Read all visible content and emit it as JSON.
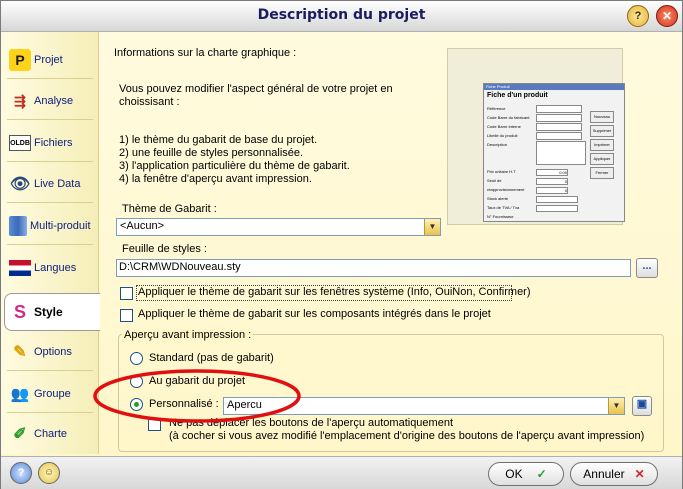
{
  "window": {
    "title": "Description du projet"
  },
  "sidebar": {
    "items": [
      {
        "label": "Projet",
        "icon": "p-icon"
      },
      {
        "label": "Analyse",
        "icon": "analysis-icon"
      },
      {
        "label": "Fichiers",
        "icon": "oldb-icon"
      },
      {
        "label": "Live Data",
        "icon": "eye-icon"
      },
      {
        "label": "Multi-produit",
        "icon": "books-icon"
      },
      {
        "label": "Langues",
        "icon": "flag-icon"
      },
      {
        "label": "Style",
        "icon": "style-icon",
        "selected": true
      },
      {
        "label": "Options",
        "icon": "pencil-icon"
      },
      {
        "label": "Groupe",
        "icon": "group-icon"
      },
      {
        "label": "Charte",
        "icon": "charte-icon"
      }
    ],
    "oldb_text": "OLDB"
  },
  "main": {
    "heading": "Informations sur la charte graphique :",
    "intro_line1": "Vous pouvez modifier l'aspect général de votre projet en",
    "intro_line2": "choissisant :",
    "list": [
      "1) le thème du gabarit de base du projet.",
      "2) une feuille de styles personnalisée.",
      "3) l'application particulière du thème de gabarit.",
      "4) la fenêtre d'aperçu avant impression."
    ],
    "theme_label": "Thème de Gabarit :",
    "theme_value": "<Aucun>",
    "stylesheet_label": "Feuille de styles :",
    "stylesheet_value": "D:\\CRM\\WDNouveau.sty",
    "browse_label": "...",
    "check_system": "Appliquer le thème de gabarit sur les fenêtres système (Info, OuiNon, Confirmer)",
    "check_components": "Appliquer le thème de gabarit sur les composants intégrés dans le projet",
    "preview_group": "Aperçu avant impression :",
    "radio_standard": "Standard (pas de gabarit)",
    "radio_gabarit": "Au gabarit du projet",
    "radio_custom": "Personnalisé :",
    "custom_value": "Apercu",
    "check_nomove": "Ne pas déplacer les boutons de l'aperçu automatiquement",
    "check_nomove_note": "(à cocher si vous avez modifié l'emplacement d'origine des boutons de l'aperçu avant impression)",
    "annotation_color": "#e01010"
  },
  "preview_window": {
    "title": "Fiche Produit",
    "heading": "Fiche d'un produit",
    "fields": [
      "Référence",
      "Code Barre du fabricant",
      "Code Barre interne",
      "Libellé du produit",
      "Description",
      "Prix unitaire H.T",
      "Seuil de réapprovisionnement",
      "Stock alerte",
      "Taux de TVA / Tva",
      "N° Fournisseur"
    ],
    "buttons": [
      "Nouveau",
      "Supprimer",
      "Imprimer",
      "Appliquer",
      "Fermer"
    ],
    "values": [
      "0.00",
      "0",
      "0"
    ]
  },
  "footer": {
    "ok_label": "OK",
    "cancel_label": "Annuler"
  }
}
